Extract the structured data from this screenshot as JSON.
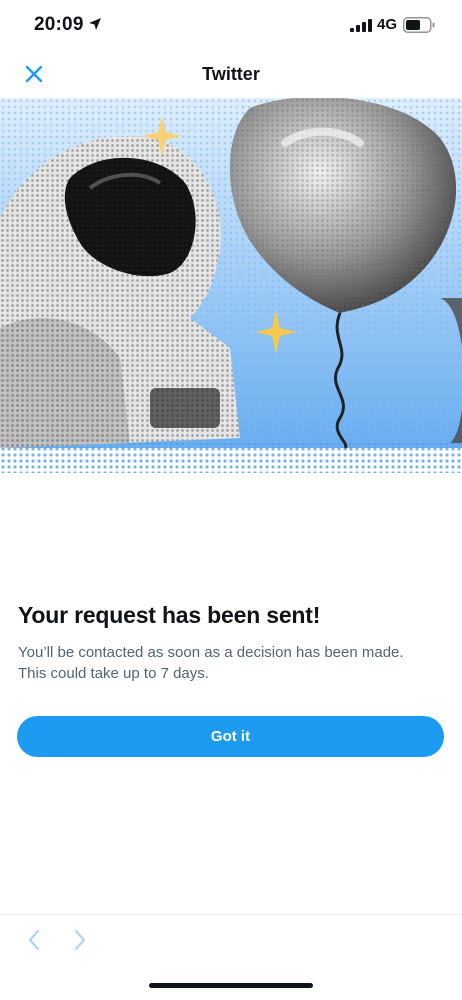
{
  "status_bar": {
    "time": "20:09",
    "network": "4G",
    "icons": [
      "location-arrow-icon",
      "signal-icon",
      "battery-icon"
    ]
  },
  "nav": {
    "title": "Twitter",
    "close_icon": "close-icon"
  },
  "hero": {
    "description_icons": [
      "astronaut-illustration",
      "balloon-illustration",
      "sparkle-icon"
    ]
  },
  "message": {
    "headline": "Your request has been sent!",
    "body_line1": "You’ll be contacted as soon as a decision has been made.",
    "body_line2": "This could take up to 7 days."
  },
  "actions": {
    "got_it_label": "Got it"
  },
  "toolbar": {
    "back_icon": "chevron-left-icon",
    "forward_icon": "chevron-right-icon"
  },
  "colors": {
    "accent": "#1d9bf0",
    "text_primary": "#0f1419",
    "text_secondary": "#536471",
    "toolbar_icon": "#a9d4f5"
  }
}
